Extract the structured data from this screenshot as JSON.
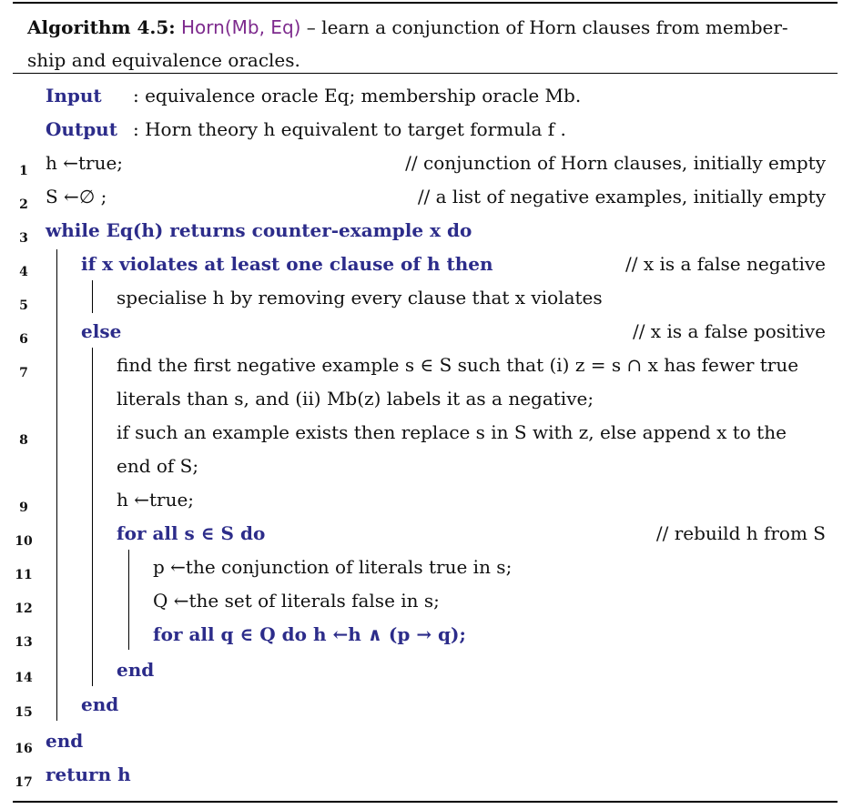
{
  "caption": {
    "label": "Algorithm 4.5:",
    "name": "Horn(Mb, Eq)",
    "description_line1": " – learn a conjunction of Horn clauses from member-",
    "description_line2": "ship and equivalence oracles."
  },
  "io": {
    "input_label": "Input",
    "input_text": ": equivalence oracle Eq; membership oracle Mb.",
    "output_label": "Output",
    "output_text": ": Horn theory h equivalent to target formula f ."
  },
  "lines": [
    {
      "num": "1",
      "text": "h ←true;",
      "comment": "// conjunction of Horn clauses, initially empty"
    },
    {
      "num": "2",
      "text": "S ←∅ ;",
      "comment": "// a list of negative examples, initially empty"
    },
    {
      "num": "3",
      "text": "while Eq(h) returns counter-example x do",
      "comment": ""
    },
    {
      "num": "4",
      "text": "if x violates at least one clause of h then",
      "comment": "// x is a false negative"
    },
    {
      "num": "5",
      "text": "specialise h by removing every clause that x violates",
      "comment": ""
    },
    {
      "num": "6",
      "text": "else",
      "comment": "// x is a false positive"
    },
    {
      "num": "7",
      "text": "find the first negative example s ∈ S such that (i) z = s ∩ x has fewer true",
      "text2": "literals than s, and (ii) Mb(z) labels it as a negative;",
      "comment": ""
    },
    {
      "num": "8",
      "text": "if such an example exists then replace s in S with z, else append x to the",
      "text2": "end of S;",
      "comment": ""
    },
    {
      "num": "9",
      "text": "h ←true;",
      "comment": ""
    },
    {
      "num": "10",
      "text": "for all s ∈ S do",
      "comment": "// rebuild h from S"
    },
    {
      "num": "11",
      "text": "p ←the conjunction of literals true in s;",
      "comment": ""
    },
    {
      "num": "12",
      "text": "Q ←the set of literals false in s;",
      "comment": ""
    },
    {
      "num": "13",
      "text": "for all q ∈ Q do h ←h ∧ (p → q);",
      "comment": ""
    },
    {
      "num": "14",
      "text": "end",
      "comment": ""
    },
    {
      "num": "15",
      "text": "end",
      "comment": ""
    },
    {
      "num": "16",
      "text": "end",
      "comment": ""
    },
    {
      "num": "17",
      "text": "return h",
      "comment": ""
    }
  ]
}
